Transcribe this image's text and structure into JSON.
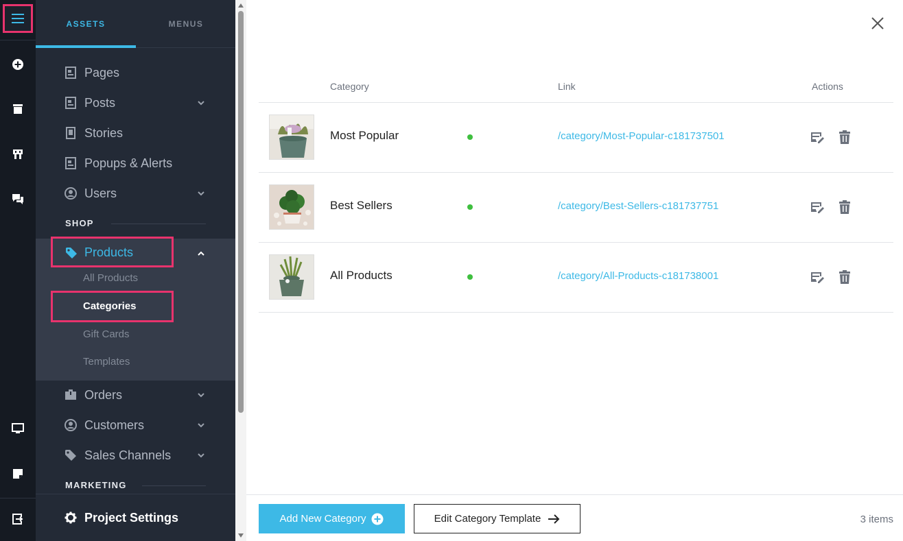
{
  "nav_tabs": {
    "assets": "ASSETS",
    "menus": "MENUS"
  },
  "nav_items": {
    "pages": "Pages",
    "posts": "Posts",
    "stories": "Stories",
    "popups": "Popups & Alerts",
    "users": "Users"
  },
  "sections": {
    "shop": "SHOP",
    "marketing": "MARKETING"
  },
  "shop": {
    "products": "Products",
    "all_products": "All Products",
    "categories": "Categories",
    "gift_cards": "Gift Cards",
    "templates": "Templates",
    "orders": "Orders",
    "customers": "Customers",
    "sales_channels": "Sales Channels"
  },
  "project_settings": "Project Settings",
  "table": {
    "headers": {
      "category": "Category",
      "link": "Link",
      "actions": "Actions"
    },
    "rows": [
      {
        "name": "Most Popular",
        "link": "/category/Most-Popular-c181737501",
        "status": "active"
      },
      {
        "name": "Best Sellers",
        "link": "/category/Best-Sellers-c181737751",
        "status": "active"
      },
      {
        "name": "All Products",
        "link": "/category/All-Products-c181738001",
        "status": "active"
      }
    ]
  },
  "footer": {
    "add_label": "Add New Category",
    "edit_template_label": "Edit Category Template",
    "count": "3 items"
  },
  "colors": {
    "accent": "#3db9e6",
    "highlight": "#e8336d",
    "status_active": "#3fbf3f",
    "sidebar_bg": "#232a36",
    "rail_bg": "#151a22"
  },
  "icons": [
    "hamburger-icon",
    "add-circle-icon",
    "archive-icon",
    "store-icon",
    "chat-icon",
    "monitor-icon",
    "note-icon",
    "exit-icon",
    "page-icon",
    "user-icon",
    "tag-icon",
    "box-icon",
    "gear-icon",
    "chevron-down-icon",
    "chevron-up-icon",
    "close-icon",
    "edit-icon",
    "trash-icon",
    "arrow-right-icon",
    "plus-circle-icon"
  ]
}
